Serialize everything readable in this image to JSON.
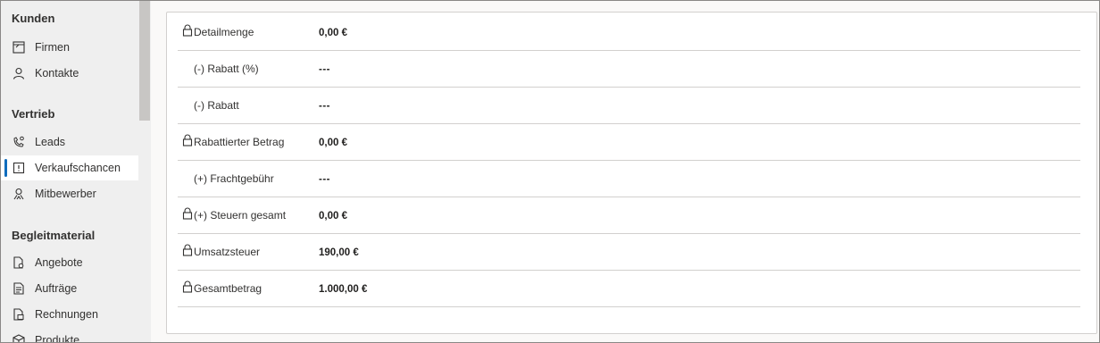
{
  "sidebar": {
    "groups": [
      {
        "title": "Kunden",
        "items": [
          {
            "label": "Firmen",
            "icon": "building-icon"
          },
          {
            "label": "Kontakte",
            "icon": "person-icon"
          }
        ]
      },
      {
        "title": "Vertrieb",
        "items": [
          {
            "label": "Leads",
            "icon": "phone-person-icon"
          },
          {
            "label": "Verkaufschancen",
            "icon": "opportunity-icon",
            "active": true
          },
          {
            "label": "Mitbewerber",
            "icon": "competitor-icon"
          }
        ]
      },
      {
        "title": "Begleitmaterial",
        "items": [
          {
            "label": "Angebote",
            "icon": "quote-icon"
          },
          {
            "label": "Aufträge",
            "icon": "order-icon"
          },
          {
            "label": "Rechnungen",
            "icon": "invoice-icon"
          },
          {
            "label": "Produkte",
            "icon": "product-icon"
          }
        ]
      }
    ]
  },
  "form": {
    "rows": [
      {
        "label": "Detailmenge",
        "value": "0,00 €",
        "locked": true
      },
      {
        "label": "(-) Rabatt (%)",
        "value": "---",
        "locked": false
      },
      {
        "label": "(-) Rabatt",
        "value": "---",
        "locked": false
      },
      {
        "label": "Rabattierter Betrag",
        "value": "0,00 €",
        "locked": true
      },
      {
        "label": "(+) Frachtgebühr",
        "value": "---",
        "locked": false
      },
      {
        "label": "(+) Steuern gesamt",
        "value": "0,00 €",
        "locked": true
      },
      {
        "label": "Umsatzsteuer",
        "value": "190,00 €",
        "locked": true
      },
      {
        "label": "Gesamtbetrag",
        "value": "1.000,00 €",
        "locked": true
      }
    ]
  },
  "colors": {
    "accent": "#0f6cbd",
    "sidebar_bg": "#efefef",
    "border": "#d2d0ce"
  }
}
